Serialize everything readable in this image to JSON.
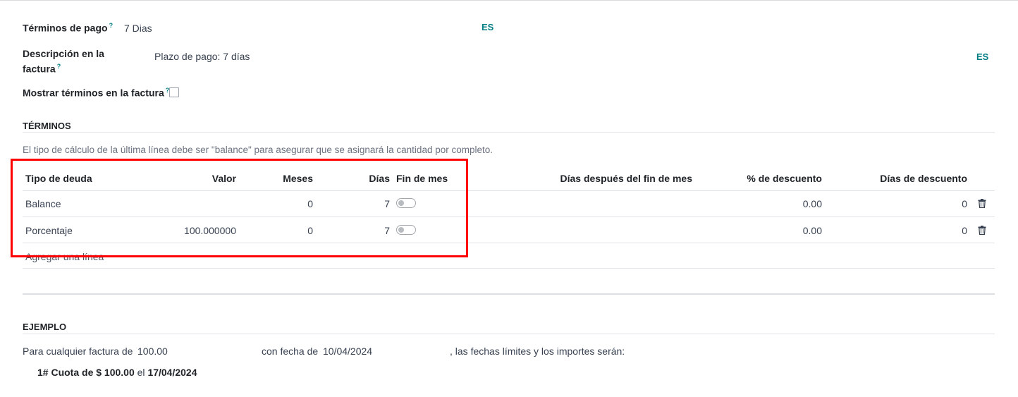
{
  "form": {
    "payment_terms": {
      "label": "Términos de pago",
      "help": "?",
      "value": "7 Dias",
      "lang": "ES"
    },
    "invoice_desc": {
      "label_line1": "Descripción en la",
      "label_line2": "factura",
      "help": "?",
      "value": "Plazo de pago: 7 días",
      "lang": "ES"
    },
    "show_terms": {
      "label": "Mostrar términos en la factura",
      "help": "?",
      "checked": false
    }
  },
  "terms_section": {
    "title": "TÉRMINOS",
    "note": "El tipo de cálculo de la última línea debe ser \"balance\" para asegurar que se asignará la cantidad por completo.",
    "columns": {
      "debt_type": "Tipo de deuda",
      "value": "Valor",
      "months": "Meses",
      "days": "Días",
      "end_of_month": "Fin de mes",
      "days_after_eom": "Días después del fin de mes",
      "discount_pct": "% de descuento",
      "discount_days": "Días de descuento"
    },
    "rows": [
      {
        "debt_type": "Balance",
        "value": "",
        "months": "0",
        "days": "7",
        "end_of_month": false,
        "discount_pct": "0.00",
        "discount_days": "0"
      },
      {
        "debt_type": "Porcentaje",
        "value": "100.000000",
        "months": "0",
        "days": "7",
        "end_of_month": false,
        "discount_pct": "0.00",
        "discount_days": "0"
      }
    ],
    "add_line": "Agregar una línea"
  },
  "example_section": {
    "title": "EJEMPLO",
    "for_any_invoice": "Para cualquier factura de",
    "amount": "100.00",
    "with_date": "con fecha de",
    "date": "10/04/2024",
    "suffix": ", las fechas límites y los importes serán:",
    "installment": {
      "prefix": "1# Cuota de",
      "amount": "$ 100.00",
      "on": "el",
      "date": "17/04/2024"
    }
  },
  "colors": {
    "accent": "#017e84",
    "highlight": "#ff0000"
  }
}
